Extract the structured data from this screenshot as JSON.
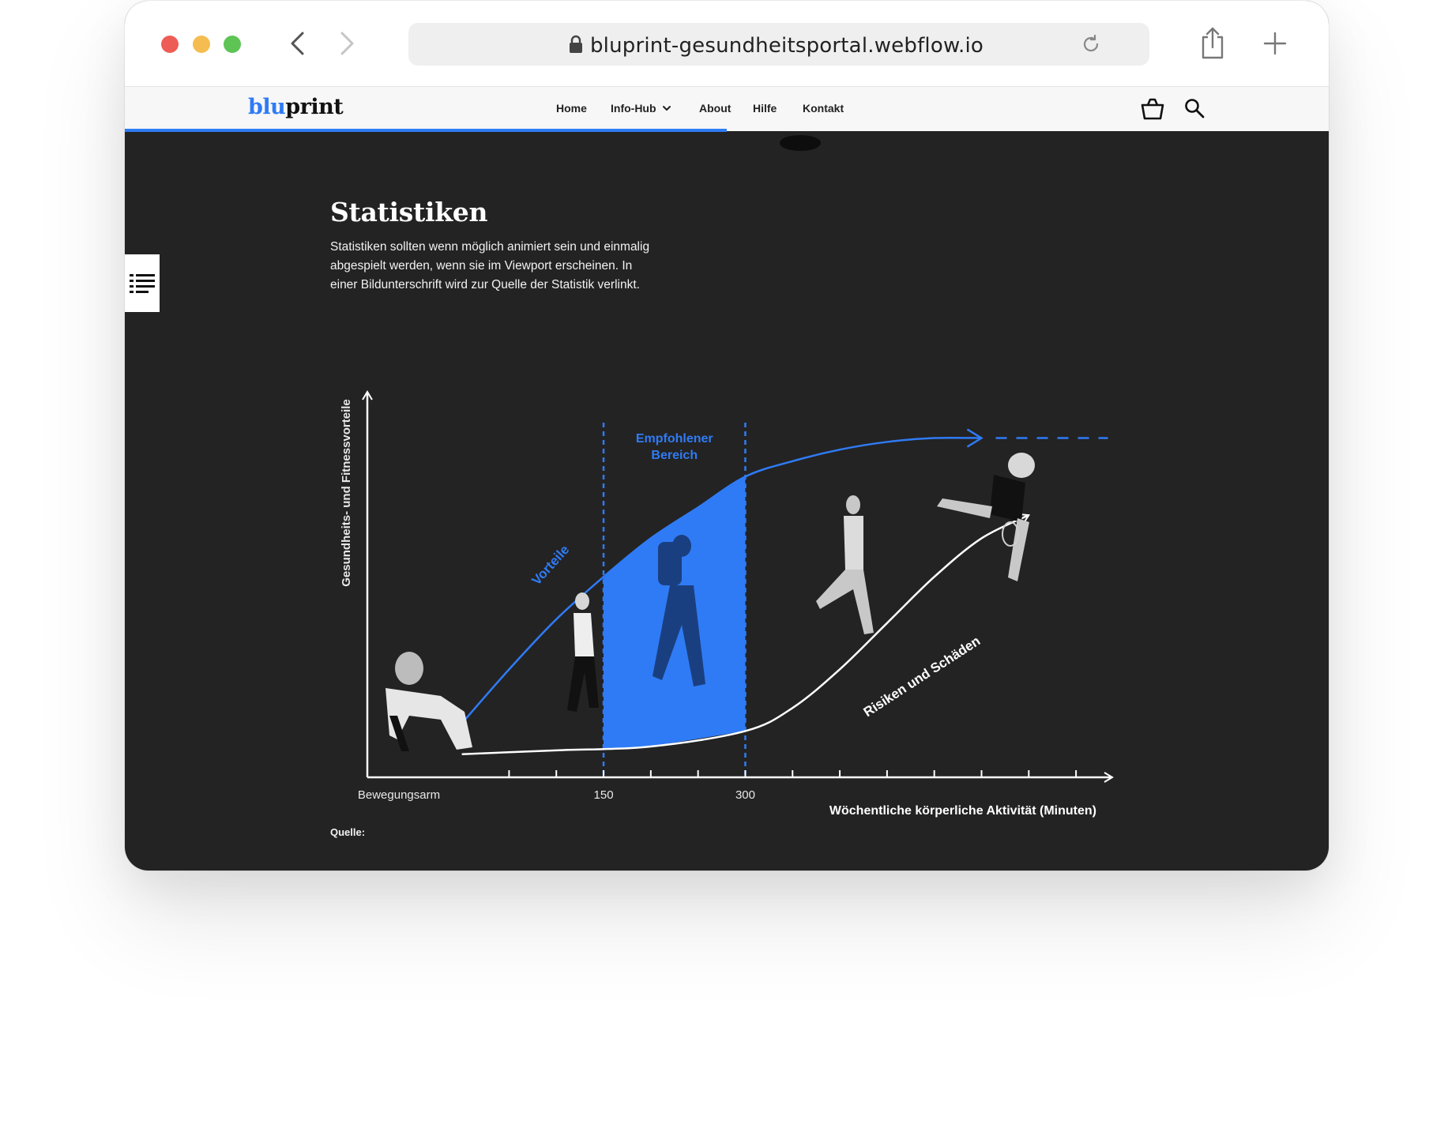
{
  "browser": {
    "url": "bluprint-gesundheitsportal.webflow.io"
  },
  "site": {
    "logo_part1": "blu",
    "logo_part2": "print",
    "nav": [
      {
        "label": "Home"
      },
      {
        "label": "Info-Hub"
      },
      {
        "label": "About"
      },
      {
        "label": "Hilfe"
      },
      {
        "label": "Kontakt"
      }
    ],
    "scroll_progress": 0.5
  },
  "section": {
    "title": "Statistiken",
    "body": "Statistiken sollten wenn möglich animiert sein und einmalig abgespielt werden, wenn sie im Viewport erscheinen. In einer Bildunterschrift wird zur Quelle der Statistik verlinkt.",
    "source_label": "Quelle:"
  },
  "colors": {
    "accent": "#2f7bf5",
    "page_bg": "#232323",
    "text_light": "#ffffff"
  },
  "chart_data": {
    "type": "area",
    "xlabel": "Wöchentliche körperliche Aktivität (Minuten)",
    "ylabel": "Gesundheits- und Fitnessvorteile",
    "x_tick_labels": [
      "Bewegungsarm",
      "150",
      "300"
    ],
    "x_ticks": [
      0,
      50,
      100,
      150,
      200,
      250,
      300,
      350,
      400,
      450,
      500,
      550,
      600,
      650
    ],
    "xlim": [
      -100,
      680
    ],
    "ylim": [
      0,
      1
    ],
    "highlight_band": {
      "label": "Empfohlener Bereich",
      "x_start": 150,
      "x_end": 300
    },
    "series": [
      {
        "name": "Vorteile",
        "x": [
          0,
          50,
          100,
          150,
          200,
          250,
          300,
          350,
          400,
          450,
          500,
          550
        ],
        "y": [
          0.14,
          0.28,
          0.41,
          0.52,
          0.62,
          0.7,
          0.78,
          0.82,
          0.85,
          0.87,
          0.88,
          0.88
        ],
        "extension": "dashed"
      },
      {
        "name": "Risiken und Schäden",
        "x": [
          0,
          100,
          200,
          300,
          350,
          400,
          450,
          500,
          550,
          600
        ],
        "y": [
          0.06,
          0.07,
          0.08,
          0.12,
          0.18,
          0.28,
          0.4,
          0.52,
          0.62,
          0.68
        ]
      }
    ]
  }
}
